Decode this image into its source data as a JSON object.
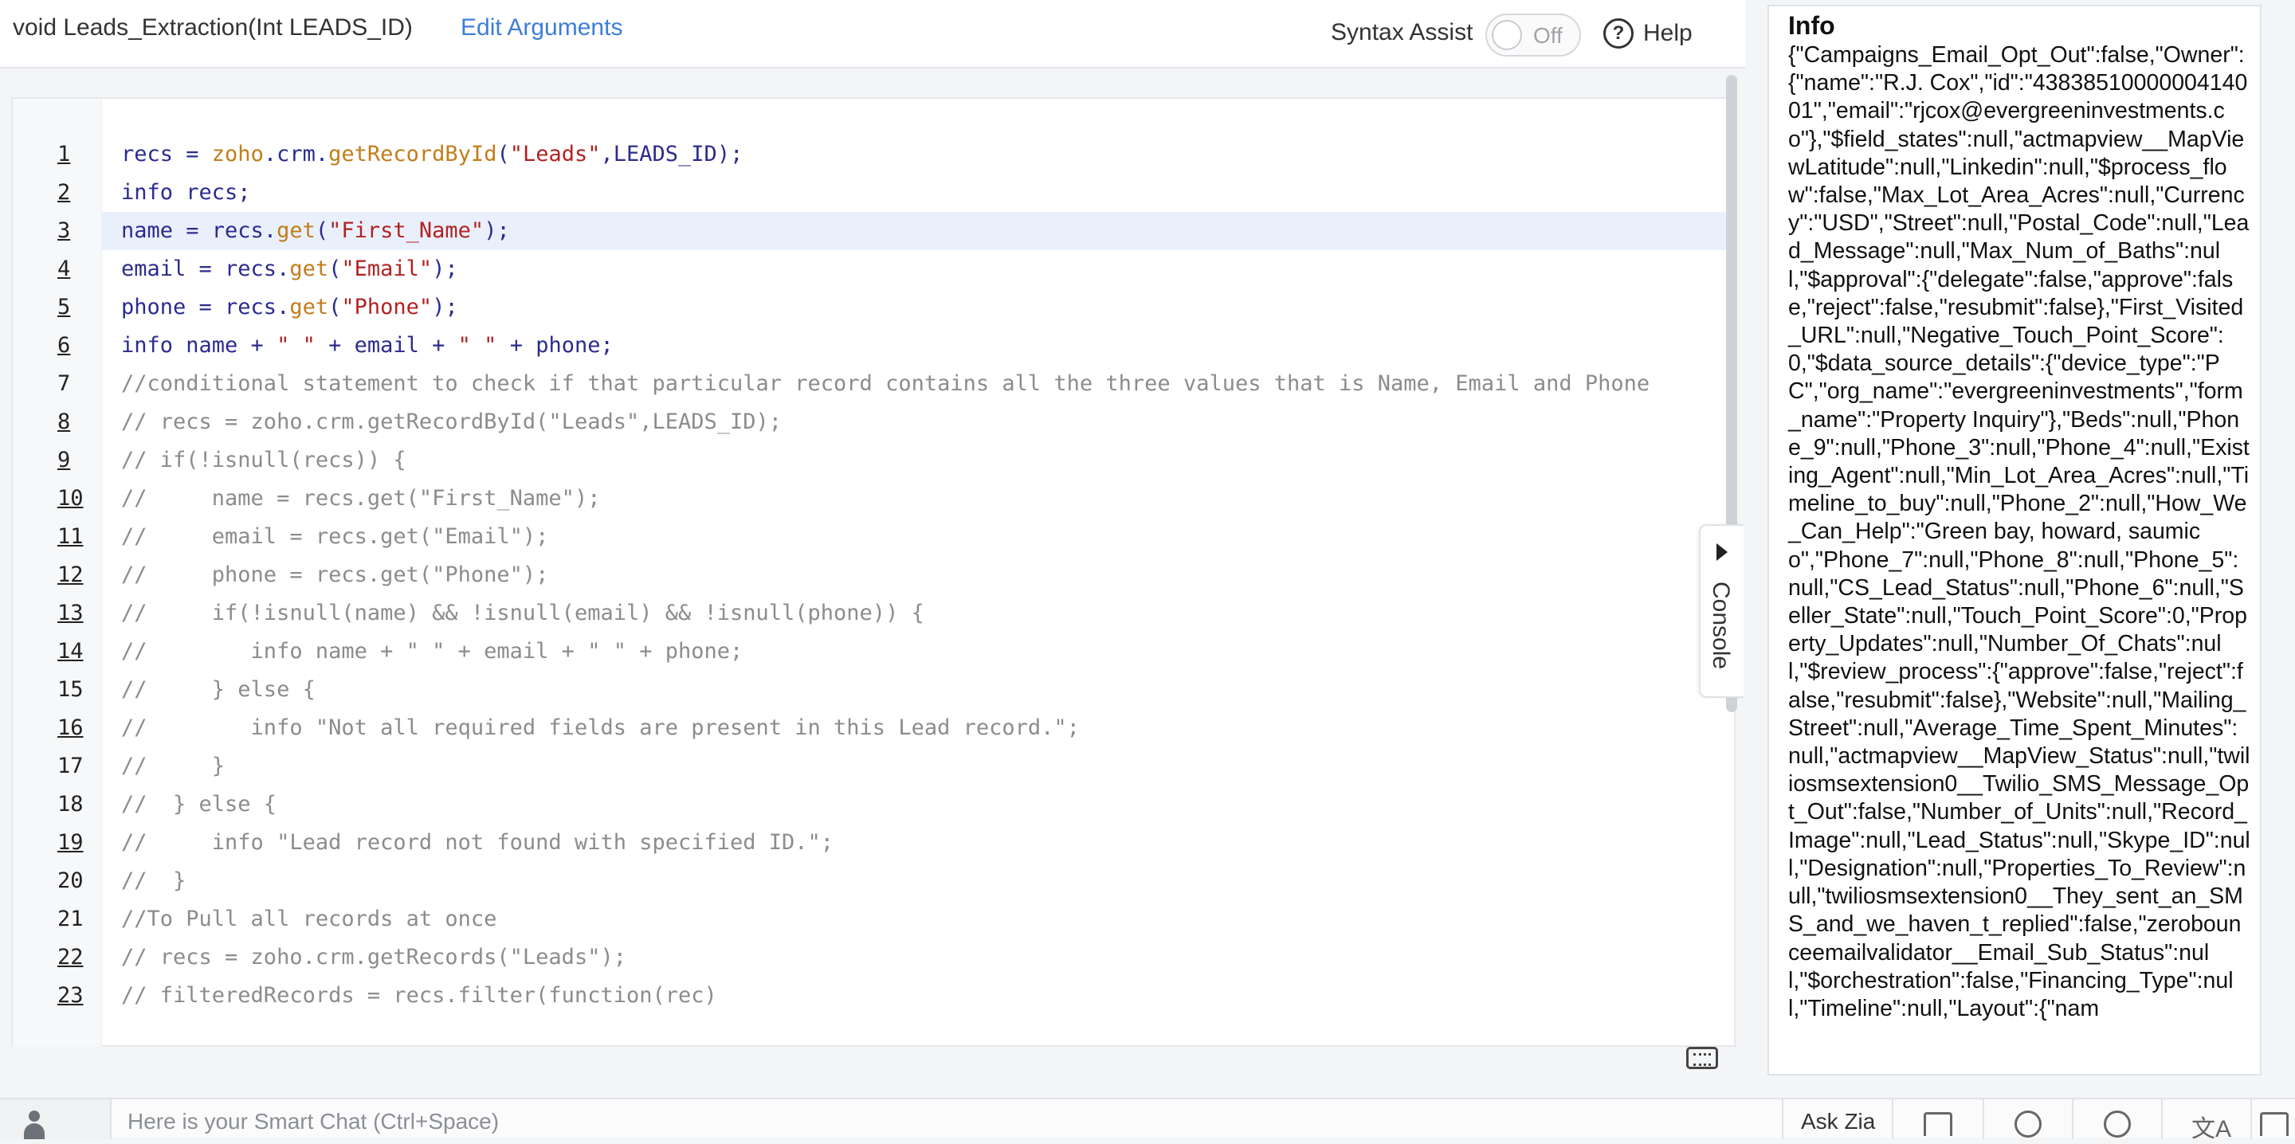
{
  "header": {
    "function_signature": "void  Leads_Extraction(Int LEADS_ID)",
    "edit_arguments": "Edit Arguments",
    "syntax_assist_label": "Syntax Assist",
    "syntax_assist_state": "Off",
    "help_label": "Help"
  },
  "editor": {
    "line_numbers": [
      "1",
      "2",
      "3",
      "4",
      "5",
      "6",
      "7",
      "8",
      "9",
      "10",
      "11",
      "12",
      "13",
      "14",
      "15",
      "16",
      "17",
      "18",
      "19",
      "20",
      "21",
      "22",
      "23"
    ],
    "underlined_lines": [
      1,
      2,
      3,
      4,
      5,
      6,
      8,
      9,
      10,
      11,
      12,
      13,
      14,
      16,
      19,
      22,
      23
    ],
    "active_line": 3,
    "lines": [
      "recs = zoho.crm.getRecordById(\"Leads\",LEADS_ID);",
      "info recs;",
      "name = recs.get(\"First_Name\");",
      "email = recs.get(\"Email\");",
      "phone = recs.get(\"Phone\");",
      "info name + \" \" + email + \" \" + phone;",
      "//conditional statement to check if that particular record contains all the three values that is Name, Email and Phone",
      "// recs = zoho.crm.getRecordById(\"Leads\",LEADS_ID);",
      "// if(!isnull(recs)) {",
      "//     name = recs.get(\"First_Name\");",
      "//     email = recs.get(\"Email\");",
      "//     phone = recs.get(\"Phone\");",
      "//     if(!isnull(name) && !isnull(email) && !isnull(phone)) {",
      "//        info name + \" \" + email + \" \" + phone;",
      "//     } else {",
      "//        info \"Not all required fields are present in this Lead record.\";",
      "//     }",
      "//  } else {",
      "//     info \"Lead record not found with specified ID.\";",
      "//  }",
      "//To Pull all records at once",
      "// recs = zoho.crm.getRecords(\"Leads\");",
      "// filteredRecords = recs.filter(function(rec)"
    ],
    "console_tab_label": "Console",
    "colors": {
      "method": "#c27d1a",
      "string": "#b22222",
      "identifier": "#2b2b8f",
      "comment": "#8c8c8c"
    }
  },
  "info_panel": {
    "title": "Info",
    "content": "{\"Campaigns_Email_Opt_Out\":false,\"Owner\":{\"name\":\"R.J. Cox\",\"id\":\"4383851000000414001\",\"email\":\"rjcox@evergreeninvestments.co\"},\"$field_states\":null,\"actmapview__MapViewLatitude\":null,\"Linkedin\":null,\"$process_flow\":false,\"Max_Lot_Area_Acres\":null,\"Currency\":\"USD\",\"Street\":null,\"Postal_Code\":null,\"Lead_Message\":null,\"Max_Num_of_Baths\":null,\"$approval\":{\"delegate\":false,\"approve\":false,\"reject\":false,\"resubmit\":false},\"First_Visited_URL\":null,\"Negative_Touch_Point_Score\":0,\"$data_source_details\":{\"device_type\":\"PC\",\"org_name\":\"evergreeninvestments\",\"form_name\":\"Property Inquiry\"},\"Beds\":null,\"Phone_9\":null,\"Phone_3\":null,\"Phone_4\":null,\"Existing_Agent\":null,\"Min_Lot_Area_Acres\":null,\"Timeline_to_buy\":null,\"Phone_2\":null,\"How_We_Can_Help\":\"Green bay, howard, saumico\",\"Phone_7\":null,\"Phone_8\":null,\"Phone_5\":null,\"CS_Lead_Status\":null,\"Phone_6\":null,\"Seller_State\":null,\"Touch_Point_Score\":0,\"Property_Updates\":null,\"Number_Of_Chats\":null,\"$review_process\":{\"approve\":false,\"reject\":false,\"resubmit\":false},\"Website\":null,\"Mailing_Street\":null,\"Average_Time_Spent_Minutes\":null,\"actmapview__MapView_Status\":null,\"twiliosmsextension0__Twilio_SMS_Message_Opt_Out\":false,\"Number_of_Units\":null,\"Record_Image\":null,\"Lead_Status\":null,\"Skype_ID\":null,\"Designation\":null,\"Properties_To_Review\":null,\"twiliosmsextension0__They_sent_an_SMS_and_we_haven_t_replied\":false,\"zerobounceemailvalidator__Email_Sub_Status\":null,\"$orchestration\":false,\"Financing_Type\":null,\"Timeline\":null,\"Layout\":{\"nam"
  },
  "bottom_bar": {
    "smart_chat_placeholder": "Here is your Smart Chat (Ctrl+Space)",
    "ask_zia": "Ask Zia",
    "icons": [
      "user-icon",
      "notes-icon",
      "history-icon",
      "alarm-icon",
      "translate-icon",
      "more-icon"
    ]
  }
}
